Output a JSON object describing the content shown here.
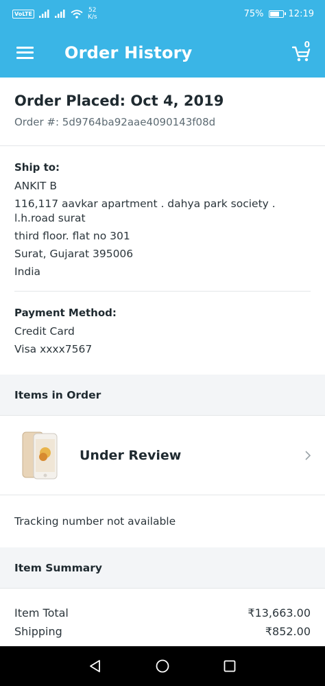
{
  "status_bar": {
    "volte": "VoLTE",
    "net_speed": "52",
    "net_unit": "K/s",
    "battery_percent": "75%",
    "battery_level": 0.75,
    "time": "12:19"
  },
  "app_bar": {
    "title": "Order History",
    "cart_count": "0"
  },
  "order": {
    "title": "Order Placed: Oct 4, 2019",
    "number": "Order #: 5d9764ba92aae4090143f08d"
  },
  "shipping": {
    "label": "Ship to:",
    "name": "ANKIT B",
    "address1": "116,117 aavkar apartment . dahya park society .",
    "address2": "l.h.road surat",
    "address3": "third floor. flat no 301",
    "city": "Surat, Gujarat 395006",
    "country": "India"
  },
  "payment": {
    "label": "Payment Method:",
    "method": "Credit Card",
    "card": "Visa xxxx7567"
  },
  "items": {
    "header": "Items in Order",
    "status": "Under Review",
    "tracking": "Tracking number not available"
  },
  "summary": {
    "header": "Item Summary",
    "rows": [
      {
        "label": "Item Total",
        "value": "₹13,663.00"
      },
      {
        "label": "Shipping",
        "value": "₹852.00"
      }
    ]
  },
  "colors": {
    "accent": "#3ab5e6",
    "section_bg": "#f3f5f7"
  }
}
